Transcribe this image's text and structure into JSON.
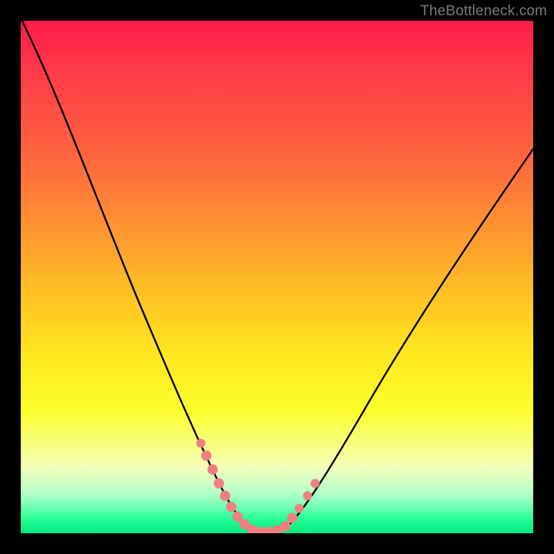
{
  "watermark": "TheBottleneck.com",
  "chart_data": {
    "type": "line",
    "title": "",
    "xlabel": "",
    "ylabel": "",
    "xlim": [
      0,
      1
    ],
    "ylim": [
      0,
      1
    ],
    "x": [
      0.0,
      0.05,
      0.1,
      0.15,
      0.2,
      0.25,
      0.3,
      0.34,
      0.37,
      0.4,
      0.42,
      0.45,
      0.48,
      0.5,
      0.55,
      0.6,
      0.7,
      0.8,
      0.9,
      1.0
    ],
    "values": [
      1.0,
      0.93,
      0.84,
      0.74,
      0.62,
      0.49,
      0.35,
      0.22,
      0.12,
      0.05,
      0.01,
      0.0,
      0.0,
      0.01,
      0.08,
      0.18,
      0.38,
      0.55,
      0.68,
      0.78
    ],
    "gradient_stops": [
      {
        "pos": 0.0,
        "color": "#ff1c49"
      },
      {
        "pos": 0.28,
        "color": "#ff6a3e"
      },
      {
        "pos": 0.55,
        "color": "#ffc722"
      },
      {
        "pos": 0.76,
        "color": "#fdff2a"
      },
      {
        "pos": 0.92,
        "color": "#b8ffc9"
      },
      {
        "pos": 1.0,
        "color": "#00e97f"
      }
    ],
    "annotation_clusters": [
      {
        "side": "left",
        "x_range": [
          0.34,
          0.42
        ],
        "y_range": [
          0.0,
          0.2
        ]
      },
      {
        "side": "right",
        "x_range": [
          0.48,
          0.55
        ],
        "y_range": [
          0.0,
          0.12
        ]
      }
    ],
    "annotation_color": "#f08080"
  }
}
